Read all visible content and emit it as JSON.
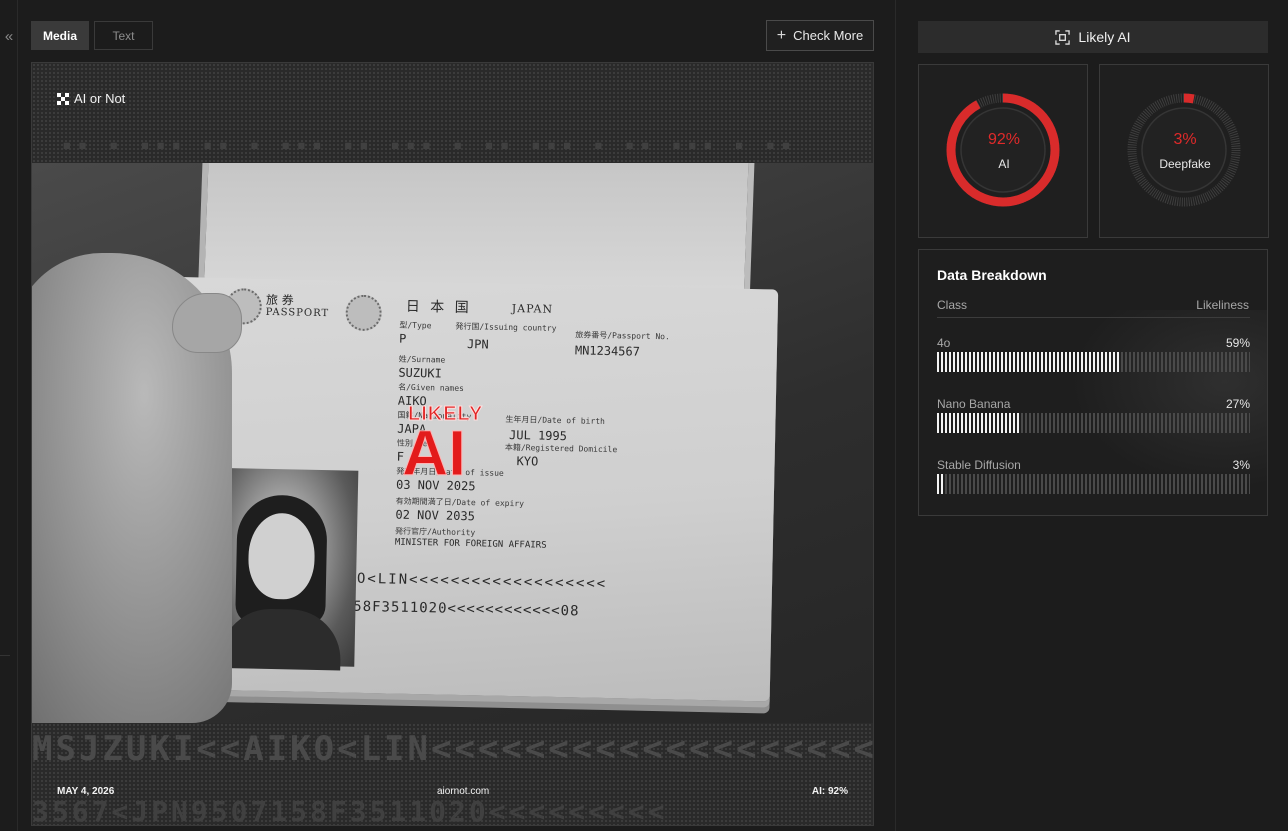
{
  "tabs": {
    "media": "Media",
    "text": "Text"
  },
  "toolbar": {
    "check_more": "Check More",
    "plus_icon": "+"
  },
  "collapse_icon": "«",
  "preview": {
    "brand": "AI or Not",
    "stamp_top": "LIKELY",
    "stamp_main": "AI",
    "footer_date": "MAY 4, 2026",
    "footer_site": "aiornot.com",
    "footer_score": "AI: 92%",
    "passport": {
      "type_label": "旅 券",
      "passport_label": "PASSPORT",
      "country_jp": "日 本 国",
      "country_en": "JAPAN",
      "type_small": "型/Type",
      "issuing_small": "発行国/Issuing country",
      "passport_no_small": "旅券番号/Passport No.",
      "type_value": "P",
      "country_code": "JPN",
      "passport_no": "MN1234567",
      "surname_small": "姓/Surname",
      "surname": "SUZUKI",
      "given_small": "名/Given names",
      "given": "AIKO",
      "nationality_small": "国籍/Nationality",
      "nationality": "JAPA",
      "dob_small": "生年月日/Date of birth",
      "dob": "JUL 1995",
      "sex_small": "性別/Sex",
      "sex": "F",
      "domicile_small": "本籍/Registered Domicile",
      "domicile": "KYO",
      "issue_small": "発行年月日/Date of issue",
      "issue": "03 NOV 2025",
      "expiry_small": "有効期間満了日/Date of expiry",
      "expiry": "02 NOV 2035",
      "authority_small": "発行官庁/Authority",
      "authority": "MINISTER FOR FOREIGN AFFAIRS",
      "mrz1": "P<JPNSUZUKI<<AIKO<LIN<<<<<<<<<<<<<<<<<<<",
      "mrz2": "MN1234567<JPN9507158F3511020<<<<<<<<<<<<08"
    },
    "bg_mrz_top": "▪▪ ▪  ▪▪▪ ▪▪  ▪ ▪▪▪  ▪▪ ▪▪▪ ▪ ▪▪  ▪▪▪ ▪ ▪▪ ▪▪▪  ▪ ▪▪",
    "bg_mrz_mid": "MSJZUKI<<AIKO<LIN<<<<<<<<<<<<<<<<<<<<",
    "bg_mrz_bot": "3567<JPN9507158F3511020<<<<<<<<<"
  },
  "result": {
    "verdict": "Likely AI",
    "scores": [
      {
        "value": "92%",
        "name": "AI",
        "fraction": 0.92
      },
      {
        "value": "3%",
        "name": "Deepfake",
        "fraction": 0.03
      }
    ],
    "accent_color": "#d92b2b"
  },
  "breakdown": {
    "title": "Data Breakdown",
    "col_class": "Class",
    "col_likeliness": "Likeliness",
    "rows": [
      {
        "name": "4o",
        "value": "59%",
        "fraction": 0.59
      },
      {
        "name": "Nano Banana",
        "value": "27%",
        "fraction": 0.27
      },
      {
        "name": "Stable Diffusion",
        "value": "3%",
        "fraction": 0.03
      }
    ]
  }
}
